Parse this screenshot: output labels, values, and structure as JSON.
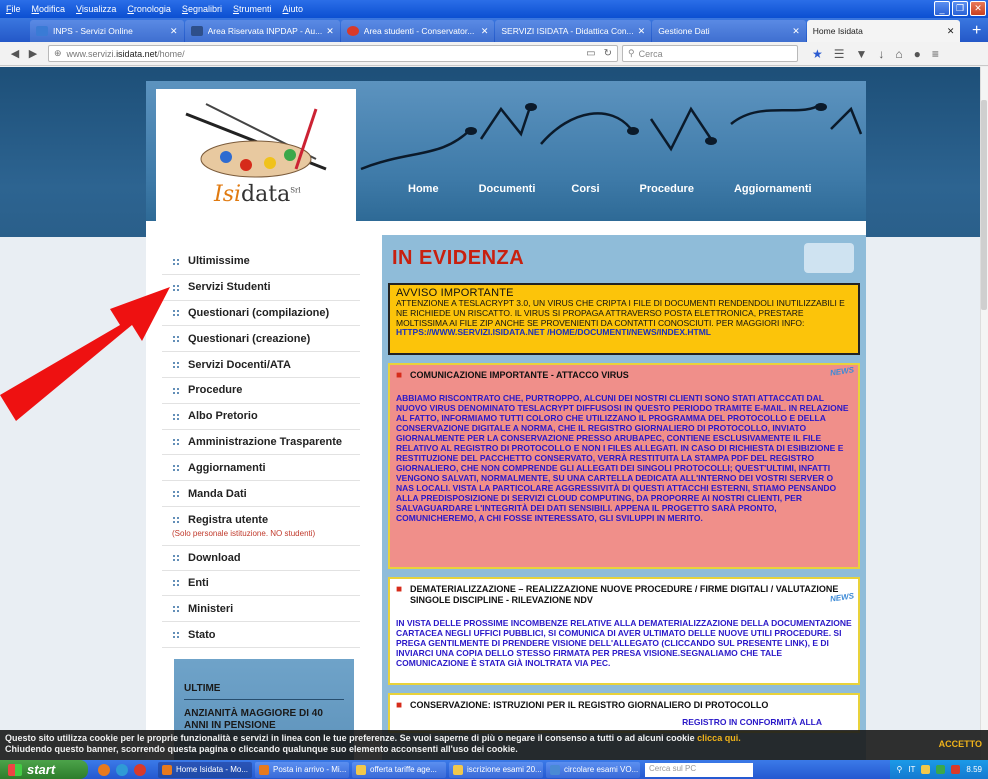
{
  "browser": {
    "menu": [
      "File",
      "Modifica",
      "Visualizza",
      "Cronologia",
      "Segnalibri",
      "Strumenti",
      "Aiuto"
    ],
    "tabs": [
      {
        "label": "INPS - Servizi Online",
        "icon_color": "#3a7bd5"
      },
      {
        "label": "Area Riservata INPDAP - Au...",
        "icon_color": "#2e4f8a"
      },
      {
        "label": "Area studenti - Conservator...",
        "icon_color": "#d83a2a"
      },
      {
        "label": "SERVIZI ISIDATA - Didattica Con...",
        "icon_color": ""
      },
      {
        "label": "Gestione Dati",
        "icon_color": ""
      },
      {
        "label": "Home Isidata",
        "icon_color": ""
      }
    ],
    "url_prefix": "www.servizi.",
    "url_host": "isidata.net",
    "url_path": "/home/",
    "search_placeholder": "Cerca"
  },
  "site": {
    "logo_part1": "Isi",
    "logo_part2": "data",
    "logo_sup": "Srl",
    "nav": [
      "Home",
      "Documenti",
      "Corsi",
      "Procedure",
      "Aggiornamenti"
    ],
    "sidebar": [
      "Ultimissime",
      "Servizi Studenti",
      "Questionari (compilazione)",
      "Questionari (creazione)",
      "Servizi Docenti/ATA",
      "Procedure",
      "Albo Pretorio",
      "Amministrazione Trasparente",
      "Aggiornamenti",
      "Manda Dati",
      "Registra utente"
    ],
    "registra_note": "(Solo personale istituzione. NO studenti)",
    "sidebar_after": [
      "Download",
      "Enti",
      "Ministeri",
      "Stato"
    ],
    "ultime_title": "ULTIME",
    "ultime_item": "ANZIANITÀ MAGGIORE DI 40 ANNI IN PENSIONE",
    "evidenza_title": "IN EVIDENZA",
    "avviso_title": "AVVISO IMPORTANTE",
    "avviso_text": "ATTENZIONE A TESLACRYPT 3.0, UN VIRUS CHE CRIPTA I FILE DI DOCUMENTI RENDENDOLI INUTILIZZABILI E NE RICHIEDE UN RISCATTO. IL VIRUS SI PROPAGA ATTRAVERSO POSTA ELETTRONICA, PRESTARE MOLTISSIMA AI FILE ZIP ANCHE SE PROVENIENTI DA CONTATTI CONOSCIUTI. PER MAGGIORI INFO: ",
    "avviso_link": "HTTPS://WWW.SERVIZI.ISIDATA.NET /HOME/DOCUMENTI/NEWS/INDEX.HTML",
    "news_badge": "NEWS",
    "news1_title": "COMUNICAZIONE IMPORTANTE - ATTACCO VIRUS",
    "news1_body": "ABBIAMO RISCONTRATO CHE, PURTROPPO, ALCUNI DEI NOSTRI CLIENTI SONO STATI ATTACCATI DAL NUOVO VIRUS DENOMINATO TESLACRYPT DIFFUSOSI IN QUESTO PERIODO TRAMITE E-MAIL. IN RELAZIONE AL FATTO, INFORMIAMO TUTTI COLORO CHE UTILIZZANO IL PROGRAMMA DEL PROTOCOLLO E DELLA CONSERVAZIONE DIGITALE A NORMA, CHE IL REGISTRO GIORNALIERO DI PROTOCOLLO, INVIATO GIORNALMENTE PER LA CONSERVAZIONE PRESSO ARUBAPEC, CONTIENE ESCLUSIVAMENTE IL FILE RELATIVO AL REGISTRO DI PROTOCOLLO E NON I FILES ALLEGATI. IN CASO DI RICHIESTA DI ESIBIZIONE E RESTITUZIONE DEL PACCHETTO CONSERVATO, VERRÀ RESTITUITA LA STAMPA PDF DEL REGISTRO GIORNALIERO, CHE NON COMPRENDE GLI ALLEGATI DEI SINGOLI PROTOCOLLI; QUEST'ULTIMI, INFATTI VENGONO SALVATI, NORMALMENTE, SU UNA CARTELLA DEDICATA ALL'INTERNO DEI VOSTRI SERVER O NAS LOCALI. VISTA LA PARTICOLARE AGGRESSIVITÀ DI QUESTI ATTACCHI ESTERNI, STIAMO PENSANDO ALLA PREDISPOSIZIONE DI SERVIZI CLOUD COMPUTING, DA PROPORRE AI NOSTRI CLIENTI, PER SALVAGUARDARE L'INTEGRITÀ DEI DATI SENSIBILI. APPENA IL PROGETTO SARÀ PRONTO, COMUNICHEREMO, A CHI FOSSE INTERESSATO, GLI SVILUPPI IN MERITO.",
    "news2_title": "DEMATERIALIZZAZIONE – REALIZZAZIONE NUOVE PROCEDURE / FIRME DIGITALI / VALUTAZIONE SINGOLE DISCIPLINE - RILEVAZIONE NDV",
    "news2_body": "IN VISTA DELLE PROSSIME INCOMBENZE RELATIVE ALLA DEMATERIALIZZAZIONE DELLA DOCUMENTAZIONE CARTACEA NEGLI UFFICI PUBBLICI, SI COMUNICA DI AVER ULTIMATO DELLE NUOVE UTILI PROCEDURE. SI PREGA GENTILMENTE DI PRENDERE VISIONE DELL'ALLEGATO (CLICCANDO SUL PRESENTE LINK), E DI INVIARCI UNA COPIA DELLO STESSO FIRMATA PER PRESA VISIONE.SEGNALIAMO CHE TALE COMUNICAZIONE È STATA GIÀ INOLTRATA VIA PEC.",
    "news3_title": "CONSERVAZIONE: ISTRUZIONI PER IL REGISTRO GIORNALIERO DI PROTOCOLLO",
    "news3_body": "REGISTRO IN CONFORMITÀ ALLA"
  },
  "cookie": {
    "text1": "Questo sito utilizza cookie per le proprie funzionalità e servizi in linea con le tue preferenze. Se vuoi saperne di più o negare il consenso a tutti o ad alcuni cookie ",
    "link": "clicca qui.",
    "text2": "Chiudendo questo banner, scorrendo questa pagina o cliccando qualunque suo elemento acconsenti all'uso dei cookie.",
    "accept": "ACCETTO"
  },
  "taskbar": {
    "start": "start",
    "tasks": [
      {
        "label": "Home Isidata - Mo...",
        "color": "#e77a1e"
      },
      {
        "label": "Posta in arrivo - Mi...",
        "color": "#e77a1e"
      },
      {
        "label": "offerta tariffe age...",
        "color": "#f2c84b"
      },
      {
        "label": "iscrizione esami 20...",
        "color": "#f2c84b"
      },
      {
        "label": "circolare esami VO...",
        "color": "#4a8ad4"
      }
    ],
    "search_placeholder": "Cerca sul PC",
    "lang": "IT",
    "clock": "8.59"
  }
}
